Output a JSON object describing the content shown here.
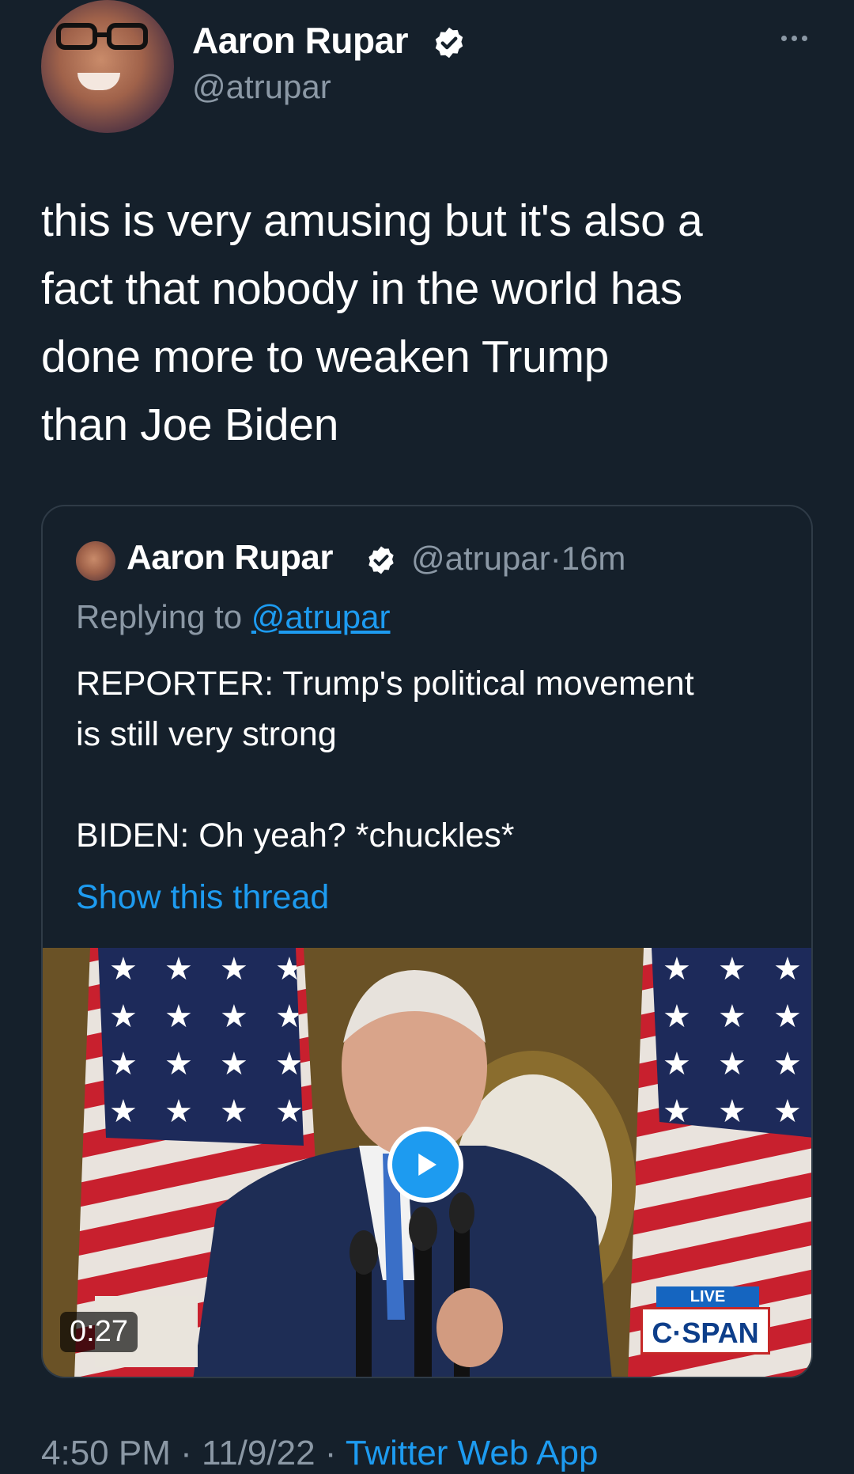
{
  "author": {
    "name": "Aaron Rupar",
    "handle": "@atrupar",
    "avatar_icon": "avatar-photo",
    "verified_icon": "verified-badge-icon"
  },
  "tweet": {
    "text": "this is very amusing but it's also a\nfact that nobody in the world has\ndone more to weaken Trump\nthan Joe Biden"
  },
  "quoted": {
    "name": "Aaron Rupar",
    "handle": "@atrupar",
    "separator": "·",
    "time": "16m",
    "replying_prefix": "Replying to",
    "replying_mention": "@atrupar",
    "text": "REPORTER: Trump's political movement\nis still very strong\n\nBIDEN: Oh yeah? *chuckles*",
    "show_thread": "Show this thread",
    "video": {
      "duration": "0:27",
      "live_label": "LIVE",
      "network_label": "C·SPAN",
      "play_icon": "play-icon"
    }
  },
  "footer": {
    "time": "4:50 PM",
    "date": "11/9/22",
    "separator": "·",
    "app": "Twitter Web App"
  },
  "colors": {
    "background": "#15202b",
    "accent": "#1d9bf0",
    "secondary_text": "#8b98a5",
    "border": "#2f3b47"
  }
}
